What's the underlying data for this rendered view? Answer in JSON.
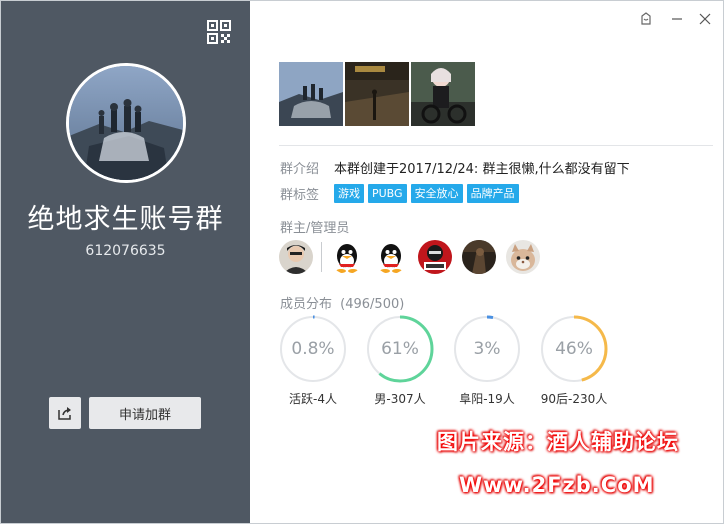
{
  "group": {
    "name": "绝地求生账号群",
    "id": "612076635"
  },
  "buttons": {
    "join_label": "申请加群"
  },
  "info": {
    "intro_label": "群介绍",
    "intro_text": "本群创建于2017/12/24:  群主很懒,什么都没有留下",
    "tags_label": "群标签",
    "tags": [
      "游戏",
      "PUBG",
      "安全放心",
      "品牌产品"
    ],
    "admins_label": "群主/管理员",
    "members_label": "成员分布",
    "members_count": "(496/500)"
  },
  "stats": [
    {
      "value": "0.8%",
      "label": "活跃-4人",
      "percent": 0.8,
      "color": "#4a90e2"
    },
    {
      "value": "61%",
      "label": "男-307人",
      "percent": 61,
      "color": "#5fd49a"
    },
    {
      "value": "3%",
      "label": "阜阳-19人",
      "percent": 3,
      "color": "#4a90e2"
    },
    {
      "value": "46%",
      "label": "90后-230人",
      "percent": 46,
      "color": "#f5b94a"
    }
  ],
  "watermark": {
    "line1": "图片来源：酒人辅助论坛",
    "line2": "Www.2Fzb.CoM"
  },
  "icons": {
    "qr": "qr-code-icon",
    "share": "share-icon",
    "skin": "skin-icon",
    "minimize": "minimize-icon",
    "close": "close-icon"
  }
}
